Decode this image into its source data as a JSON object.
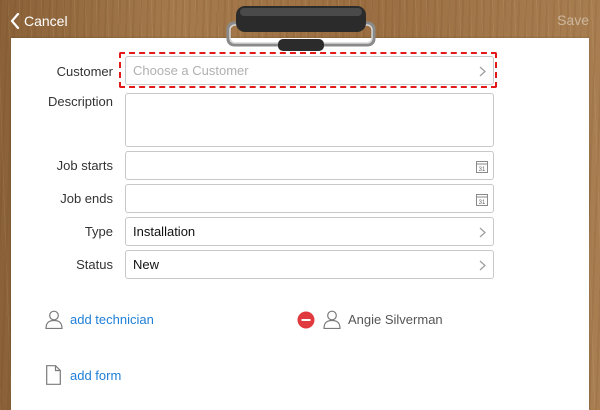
{
  "nav": {
    "cancel_label": "Cancel",
    "save_label": "Save"
  },
  "form": {
    "customer": {
      "label": "Customer",
      "placeholder": "Choose a Customer"
    },
    "description": {
      "label": "Description",
      "value": ""
    },
    "job_starts": {
      "label": "Job starts",
      "value": "",
      "calendar_day": "31"
    },
    "job_ends": {
      "label": "Job ends",
      "value": "",
      "calendar_day": "31"
    },
    "type": {
      "label": "Type",
      "value": "Installation"
    },
    "status": {
      "label": "Status",
      "value": "New"
    }
  },
  "technicians": {
    "add_label": "add technician",
    "assigned": [
      {
        "name": "Angie Silverman"
      }
    ]
  },
  "forms": {
    "add_label": "add form"
  },
  "colors": {
    "accent": "#1f7fd6",
    "remove": "#e0393e",
    "highlight": "#e21a1a"
  }
}
